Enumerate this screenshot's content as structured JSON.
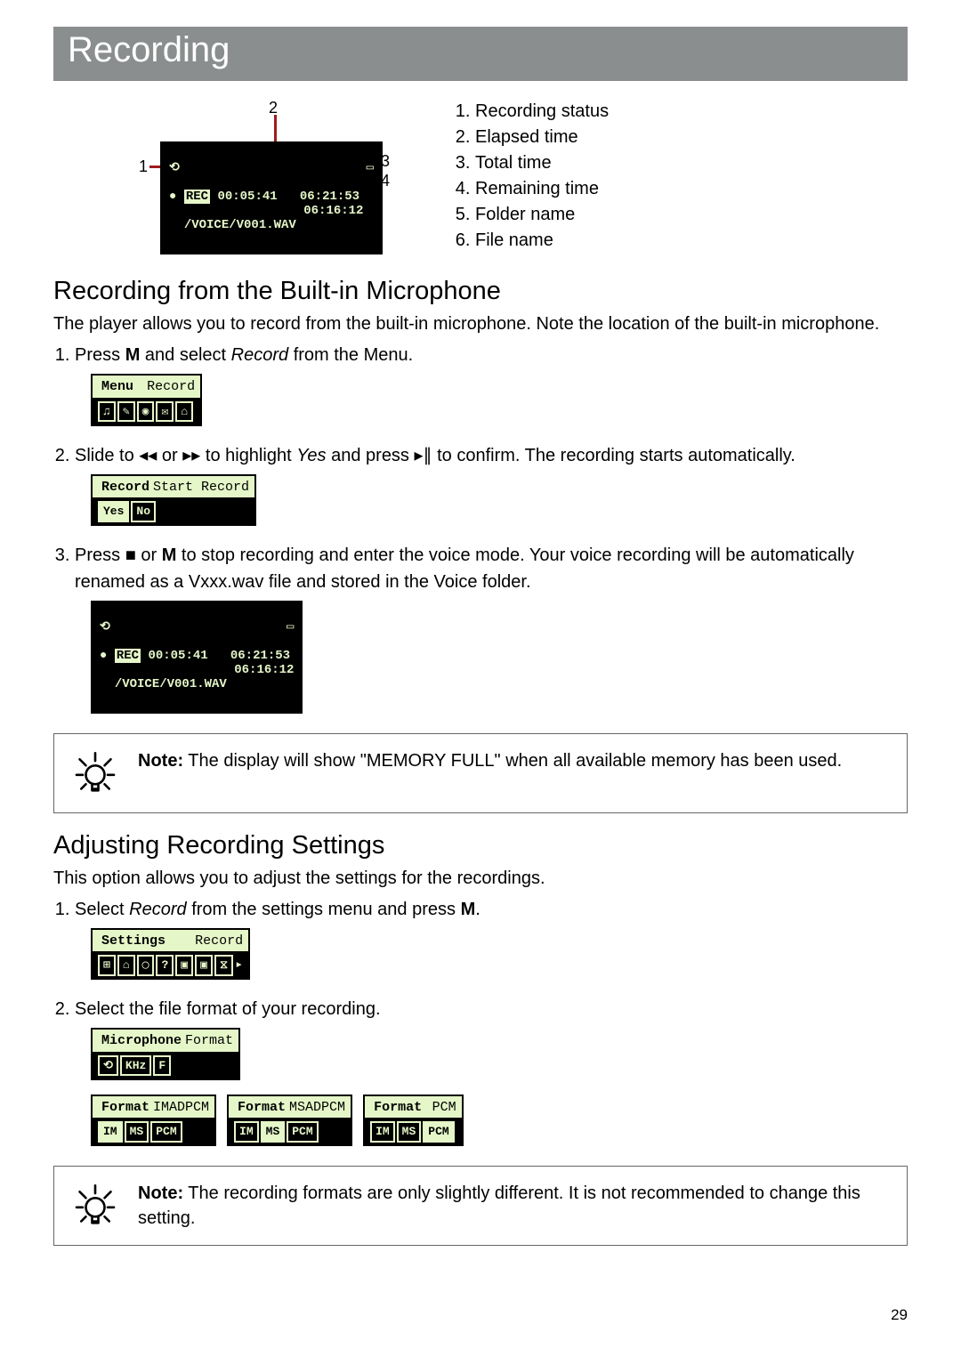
{
  "page_title": "Recording",
  "diagram_labels": [
    "Recording status",
    "Elapsed time",
    "Total time",
    "Remaining time",
    "Folder name",
    "File name"
  ],
  "diagram_numbers": [
    "1",
    "2",
    "3",
    "4",
    "5",
    "6"
  ],
  "rec_screen": {
    "elapsed": "00:05:41",
    "total": "06:21:53",
    "remaining": "06:16:12",
    "path": "/VOICE/V001.WAV",
    "rec_label": "REC"
  },
  "section1": {
    "heading": "Recording from the Built-in Microphone",
    "intro": "The player allows you to record from the built-in microphone. Note the location of the built-in microphone.",
    "steps": {
      "s1_a": "Press ",
      "s1_b": "M",
      "s1_c": " and select ",
      "s1_d": "Record",
      "s1_e": " from the Menu.",
      "s2_a": "Slide to ",
      "s2_b": " or ",
      "s2_c": " to highlight ",
      "s2_d": "Yes",
      "s2_e": " and press ",
      "s2_f": " to confirm. The recording starts automatically.",
      "s3_a": "Press ",
      "s3_b": " or ",
      "s3_c": "M",
      "s3_d": " to stop recording and enter the voice mode. Your voice recording will be automatically renamed as a Vxxx.wav file and stored in the Voice folder."
    },
    "lcd_menu": {
      "tab": "Menu",
      "right": "Record"
    },
    "lcd_record": {
      "tab": "Record",
      "right": "Start Record",
      "opt1": "Yes",
      "opt2": "No"
    }
  },
  "note1_a": "Note:",
  "note1_b": " The display will show \"MEMORY FULL\" when all available memory has been used.",
  "section2": {
    "heading": "Adjusting Recording Settings",
    "intro": "This option allows you to adjust the settings for the recordings.",
    "steps": {
      "s1_a": "Select ",
      "s1_b": "Record",
      "s1_c": " from the settings menu and press ",
      "s1_d": "M",
      "s1_e": ".",
      "s2": "Select the file format of your recording."
    },
    "lcd_settings": {
      "tab": "Settings",
      "right": "Record"
    },
    "lcd_mic": {
      "tab": "Microphone",
      "right": "Format"
    },
    "formats": {
      "tab": "Format",
      "f1": "IMADPCM",
      "f2": "MSADPCM",
      "f3": "PCM",
      "opts": [
        "IM",
        "MS",
        "PCM"
      ]
    }
  },
  "note2_a": "Note:",
  "note2_b": " The recording formats are only slightly different. It is not recommended to change this setting.",
  "page_number": "29",
  "icons": {
    "prev": "◂◂",
    "next": "▸▸",
    "playpause": "▸∥",
    "stop": "■"
  }
}
